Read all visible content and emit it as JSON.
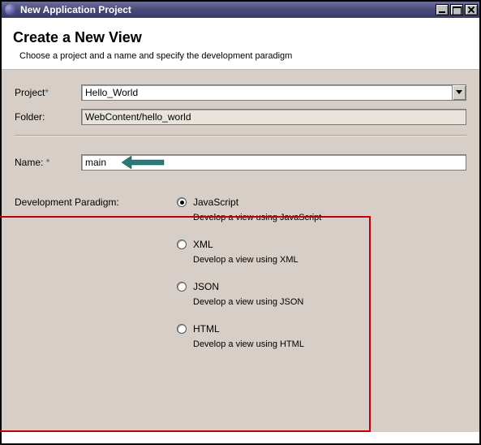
{
  "window": {
    "title": "New Application Project"
  },
  "banner": {
    "heading": "Create a New View",
    "description": "Choose a project and a name and specify the development paradigm"
  },
  "form": {
    "project_label": "Project",
    "project_value": "Hello_World",
    "folder_label": "Folder:",
    "folder_value": "WebContent/hello_world",
    "name_label": "Name:",
    "name_value": "main",
    "required_mark": "*"
  },
  "paradigm": {
    "label": "Development Paradigm:",
    "options": [
      {
        "label": "JavaScript",
        "description": "Develop a view using JavaScript",
        "selected": true
      },
      {
        "label": "XML",
        "description": "Develop a view using XML",
        "selected": false
      },
      {
        "label": "JSON",
        "description": "Develop a view using JSON",
        "selected": false
      },
      {
        "label": "HTML",
        "description": "Develop a view using HTML",
        "selected": false
      }
    ]
  }
}
